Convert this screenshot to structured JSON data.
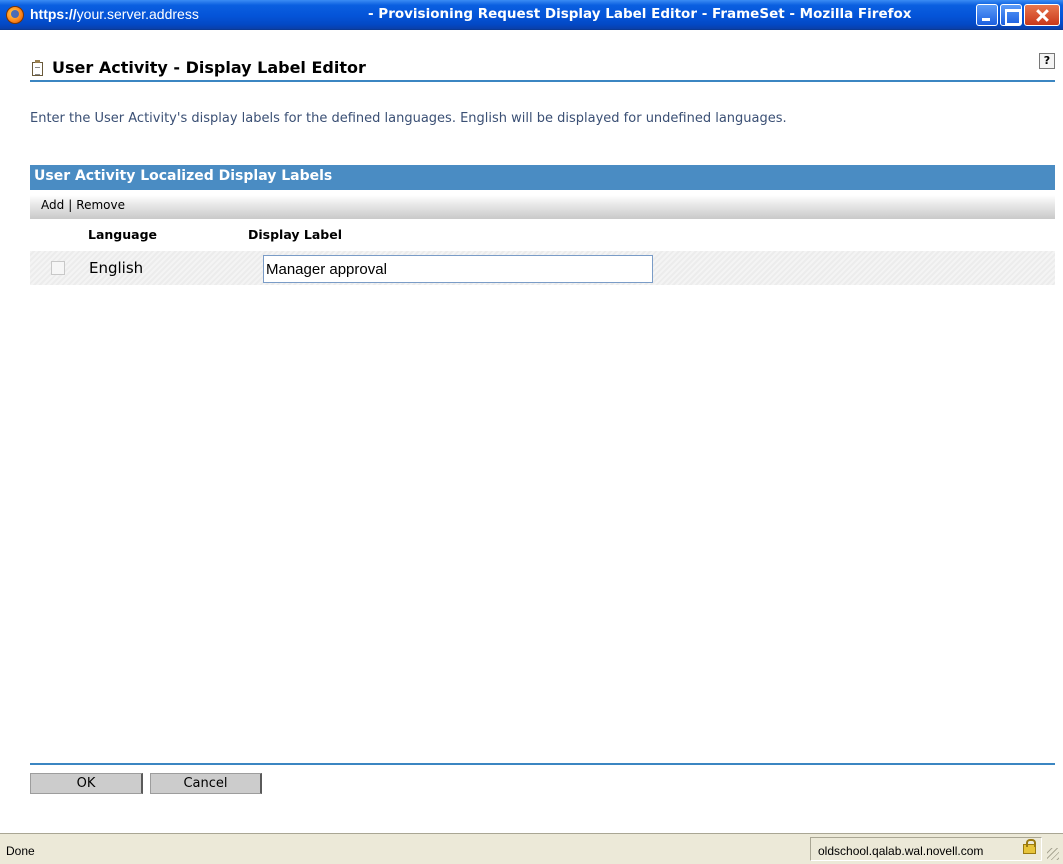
{
  "window": {
    "url_scheme": "https://",
    "url_rest": "your.server.address",
    "title": "- Provisioning Request Display Label Editor - FrameSet - Mozilla Firefox"
  },
  "header": {
    "title": "User Activity - Display Label Editor",
    "help": "?"
  },
  "instructions": "Enter the User Activity's display labels for the defined languages.  English will be displayed for undefined languages.",
  "table": {
    "title": "User Activity Localized Display Labels",
    "toolbar": {
      "add": "Add",
      "separator": "|",
      "remove": "Remove"
    },
    "columns": {
      "language": "Language",
      "display_label": "Display Label"
    },
    "rows": [
      {
        "language": "English",
        "display_label": "Manager approval",
        "checked": false
      }
    ]
  },
  "buttons": {
    "ok": "OK",
    "cancel": "Cancel"
  },
  "status": {
    "text": "Done",
    "host": "oldschool.qalab.wal.novell.com"
  },
  "colors": {
    "title_bar": "#0454d8",
    "accent_rule": "#3b86c2",
    "table_header": "#4a8cc3",
    "instructions_text": "#3a4f74"
  },
  "icons": [
    "firefox-icon",
    "minimize-icon",
    "maximize-icon",
    "close-icon",
    "document-icon",
    "help-icon",
    "lock-icon"
  ]
}
